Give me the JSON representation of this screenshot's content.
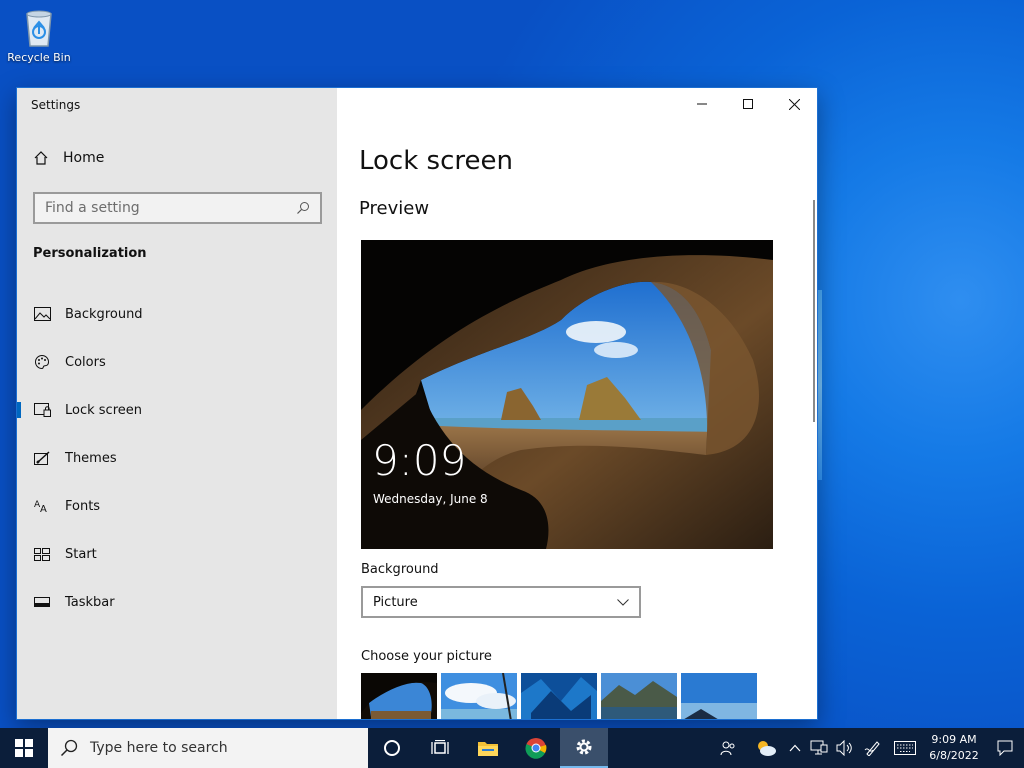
{
  "desktop": {
    "recycle_bin_label": "Recycle Bin"
  },
  "window": {
    "title": "Settings",
    "sidebar": {
      "home_label": "Home",
      "search_placeholder": "Find a setting",
      "section_heading": "Personalization",
      "items": [
        {
          "label": "Background",
          "icon": "image-icon"
        },
        {
          "label": "Colors",
          "icon": "palette-icon"
        },
        {
          "label": "Lock screen",
          "icon": "lock-screen-icon",
          "active": true
        },
        {
          "label": "Themes",
          "icon": "brush-icon"
        },
        {
          "label": "Fonts",
          "icon": "font-icon"
        },
        {
          "label": "Start",
          "icon": "start-grid-icon"
        },
        {
          "label": "Taskbar",
          "icon": "taskbar-icon"
        }
      ]
    },
    "content": {
      "page_title": "Lock screen",
      "preview_heading": "Preview",
      "preview_time": "9:09",
      "preview_date": "Wednesday, June 8",
      "background_label": "Background",
      "background_value": "Picture",
      "choose_picture_label": "Choose your picture"
    }
  },
  "taskbar": {
    "search_placeholder": "Type here to search",
    "clock_time": "9:09 AM",
    "clock_date": "6/8/2022",
    "pinned": [
      "cortana-icon",
      "task-view-icon",
      "file-explorer-icon",
      "chrome-icon",
      "settings-icon"
    ]
  },
  "colors": {
    "accent": "#0067c0",
    "desktop": "#0a62d4",
    "taskbar": "#0b1e3a",
    "sidebar": "#e6e6e6"
  }
}
